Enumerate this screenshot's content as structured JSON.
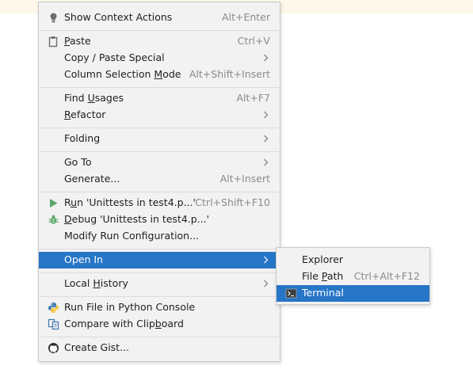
{
  "context_menu": {
    "items": [
      {
        "label": "Show Context Actions",
        "shortcut": "Alt+Enter"
      },
      {
        "label_pre": "",
        "mnemonic": "P",
        "label_post": "aste",
        "shortcut": "Ctrl+V"
      },
      {
        "label": "Copy / Paste Special"
      },
      {
        "label_pre": "Column Selection ",
        "mnemonic": "M",
        "label_post": "ode",
        "shortcut": "Alt+Shift+Insert"
      },
      {
        "label_pre": "Find ",
        "mnemonic": "U",
        "label_post": "sages",
        "shortcut": "Alt+F7"
      },
      {
        "label_pre": "",
        "mnemonic": "R",
        "label_post": "efactor"
      },
      {
        "label": "Folding"
      },
      {
        "label": "Go To"
      },
      {
        "label": "Generate...",
        "shortcut": "Alt+Insert"
      },
      {
        "label_pre": "R",
        "mnemonic": "u",
        "label_post": "n 'Unittests in test4.p...'",
        "shortcut": "Ctrl+Shift+F10"
      },
      {
        "label_pre": "",
        "mnemonic": "D",
        "label_post": "ebug 'Unittests in test4.p...'"
      },
      {
        "label": "Modify Run Configuration..."
      },
      {
        "label": "Open In"
      },
      {
        "label_pre": "Local ",
        "mnemonic": "H",
        "label_post": "istory"
      },
      {
        "label": "Run File in Python Console"
      },
      {
        "label_pre": "Compare with Clip",
        "mnemonic": "b",
        "label_post": "oard"
      },
      {
        "label": "Create Gist..."
      }
    ]
  },
  "open_in_submenu": {
    "items": [
      {
        "label": "Explorer"
      },
      {
        "label_pre": "File ",
        "mnemonic": "P",
        "label_post": "ath",
        "shortcut": "Ctrl+Alt+F12"
      },
      {
        "label": "Terminal"
      }
    ]
  },
  "colors": {
    "selection": "#2675c7",
    "menu_bg": "#f2f2f2",
    "run_green": "#59a869"
  },
  "icons": [
    "lightbulb-icon",
    "clipboard-icon",
    "run-icon",
    "debug-bug-icon",
    "python-icon",
    "compare-icon",
    "github-icon",
    "terminal-icon",
    "chevron-right-icon"
  ]
}
